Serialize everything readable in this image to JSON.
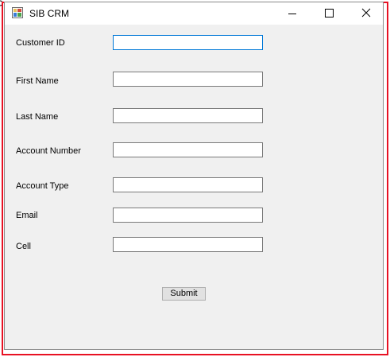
{
  "window": {
    "title": "SIB CRM",
    "icon": "app-form-icon",
    "controls": [
      "minimize-icon",
      "maximize-icon",
      "close-icon"
    ]
  },
  "form": {
    "fields": [
      {
        "label": "Customer ID",
        "value": "",
        "focused": true
      },
      {
        "label": "First Name",
        "value": ""
      },
      {
        "label": "Last Name",
        "value": ""
      },
      {
        "label": "Account Number",
        "value": ""
      },
      {
        "label": "Account Type",
        "value": ""
      },
      {
        "label": "Email",
        "value": ""
      },
      {
        "label": "Cell",
        "value": ""
      }
    ],
    "submit_label": "Submit"
  },
  "colors": {
    "highlight_border": "#e81123",
    "focus_border": "#0078d7",
    "window_bg": "#f0f0f0"
  }
}
